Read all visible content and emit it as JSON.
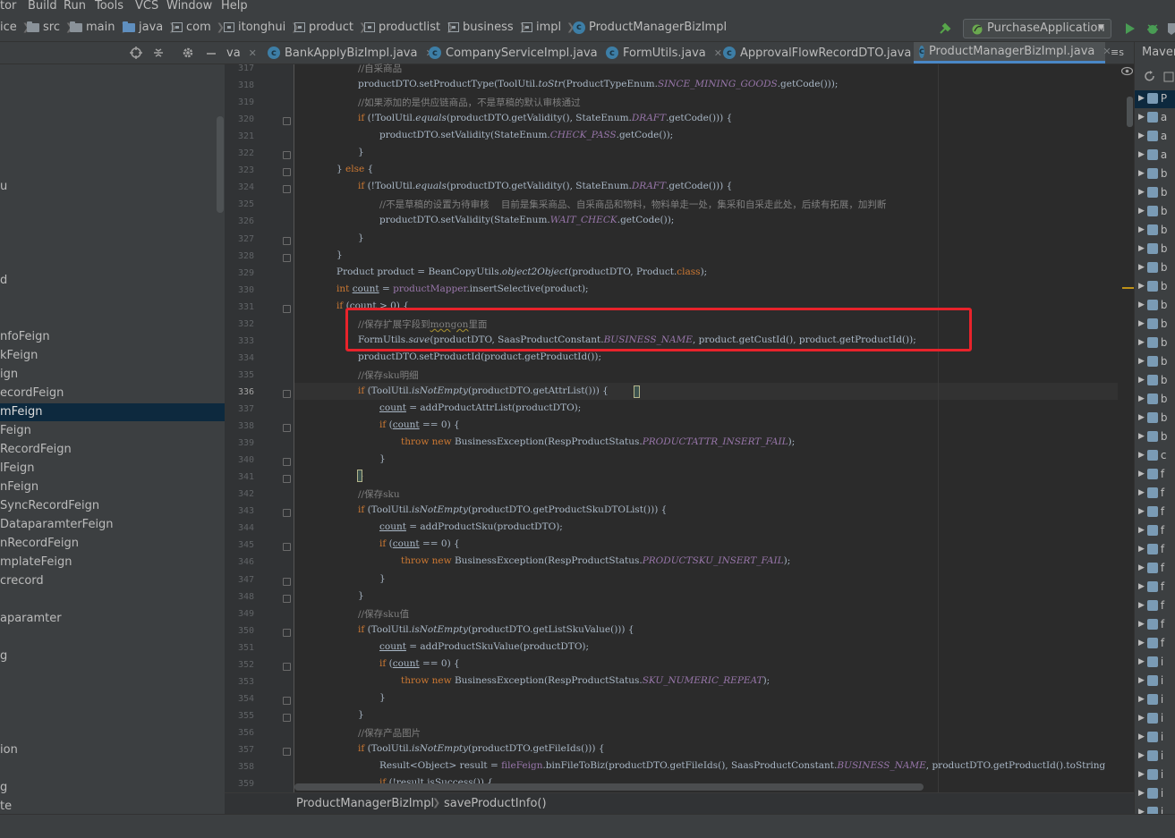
{
  "menu": [
    "tor",
    "Build",
    "Run",
    "Tools",
    "VCS",
    "Window",
    "Help"
  ],
  "breadcrumb": [
    "ice",
    "src",
    "main",
    "java",
    "com",
    "itonghui",
    "product",
    "productlist",
    "business",
    "impl",
    "ProductManagerBizImpl"
  ],
  "run_config": "PurchaseApplication",
  "tabs": [
    {
      "label": "va",
      "active": false
    },
    {
      "label": "BankApplyBizImpl.java",
      "active": false
    },
    {
      "label": "CompanyServiceImpl.java",
      "active": false
    },
    {
      "label": "FormUtils.java",
      "active": false
    },
    {
      "label": "ApprovalFlowRecordDTO.java",
      "active": false
    },
    {
      "label": "ProductManagerBizImpl.java",
      "active": true
    }
  ],
  "tabs_overflow": "≡s",
  "maven_title": "Maven",
  "project_tree": [
    {
      "label": "u",
      "selected": false
    },
    {
      "label": "d",
      "selected": false
    },
    {
      "label": "nfoFeign",
      "selected": false
    },
    {
      "label": "kFeign",
      "selected": false
    },
    {
      "label": "ign",
      "selected": false
    },
    {
      "label": "ecordFeign",
      "selected": false
    },
    {
      "label": "mFeign",
      "selected": true
    },
    {
      "label": "Feign",
      "selected": false
    },
    {
      "label": "RecordFeign",
      "selected": false
    },
    {
      "label": "lFeign",
      "selected": false
    },
    {
      "label": "nFeign",
      "selected": false
    },
    {
      "label": "SyncRecordFeign",
      "selected": false
    },
    {
      "label": "DataparamterFeign",
      "selected": false
    },
    {
      "label": "nRecordFeign",
      "selected": false
    },
    {
      "label": "mplateFeign",
      "selected": false
    },
    {
      "label": "crecord",
      "selected": false
    },
    {
      "label": "aparamter",
      "selected": false
    },
    {
      "label": "g",
      "selected": false
    },
    {
      "label": "ion",
      "selected": false
    },
    {
      "label": "g",
      "selected": false
    },
    {
      "label": "te",
      "selected": false
    }
  ],
  "line_numbers": [
    "317",
    "318",
    "319",
    "320",
    "321",
    "322",
    "323",
    "324",
    "325",
    "326",
    "327",
    "328",
    "329",
    "330",
    "331",
    "332",
    "333",
    "334",
    "335",
    "336",
    "337",
    "338",
    "339",
    "340",
    "341",
    "342",
    "343",
    "344",
    "345",
    "346",
    "347",
    "348",
    "349",
    "350",
    "351",
    "352",
    "353",
    "354",
    "355",
    "356",
    "357",
    "358",
    "359"
  ],
  "current_line": "336",
  "code": [
    [
      {
        "t": "//自采商品",
        "c": "c"
      }
    ],
    [
      {
        "t": "productDTO.setProductType(ToolUtil."
      },
      {
        "t": "toStr",
        "c": "st"
      },
      {
        "t": "(ProductTypeEnum."
      },
      {
        "t": "SINCE_MINING_GOODS",
        "c": "cst"
      },
      {
        "t": ".getCode()));"
      }
    ],
    [
      {
        "t": "//如果添加的是供应链商品，不是草稿的默认审核通过",
        "c": "c"
      }
    ],
    [
      {
        "t": "if",
        "c": "k"
      },
      {
        "t": " (!ToolUtil."
      },
      {
        "t": "equals",
        "c": "st"
      },
      {
        "t": "(productDTO.getValidity(), StateEnum."
      },
      {
        "t": "DRAFT",
        "c": "cst"
      },
      {
        "t": ".getCode())) {"
      }
    ],
    [
      {
        "t": "productDTO.setValidity(StateEnum."
      },
      {
        "t": "CHECK_PASS",
        "c": "cst"
      },
      {
        "t": ".getCode());"
      }
    ],
    [
      {
        "t": "}"
      }
    ],
    [
      {
        "t": "} "
      },
      {
        "t": "else",
        "c": "k"
      },
      {
        "t": " {"
      }
    ],
    [
      {
        "t": "if",
        "c": "k"
      },
      {
        "t": " (!ToolUtil."
      },
      {
        "t": "equals",
        "c": "st"
      },
      {
        "t": "(productDTO.getValidity(), StateEnum."
      },
      {
        "t": "DRAFT",
        "c": "cst"
      },
      {
        "t": ".getCode())) {"
      }
    ],
    [
      {
        "t": "//不是草稿的设置为待审核    目前是集采商品、自采商品和物料，物料单走一处，集采和自采走此处，后续有拓展，加判断",
        "c": "c"
      }
    ],
    [
      {
        "t": "productDTO.setValidity(StateEnum."
      },
      {
        "t": "WAIT_CHECK",
        "c": "cst"
      },
      {
        "t": ".getCode());"
      }
    ],
    [
      {
        "t": "}"
      }
    ],
    [
      {
        "t": "}"
      }
    ],
    [
      {
        "t": "Product product = BeanCopyUtils."
      },
      {
        "t": "object2Object",
        "c": "st"
      },
      {
        "t": "(productDTO, Product."
      },
      {
        "t": "class",
        "c": "k"
      },
      {
        "t": ");"
      }
    ],
    [
      {
        "t": "int",
        "c": "k"
      },
      {
        "t": " "
      },
      {
        "t": "count",
        "c": "ul"
      },
      {
        "t": " = "
      },
      {
        "t": "productMapper",
        "c": "fld"
      },
      {
        "t": ".insertSelective(product);"
      }
    ],
    [
      {
        "t": "if",
        "c": "k"
      },
      {
        "t": " ("
      },
      {
        "t": "count",
        "c": "ul"
      },
      {
        "t": " > 0) {"
      }
    ],
    [
      {
        "t": "//保存扩展字段到",
        "c": "c"
      },
      {
        "t": "mongon",
        "c": "c warn"
      },
      {
        "t": "里面",
        "c": "c"
      }
    ],
    [
      {
        "t": "FormUtils."
      },
      {
        "t": "save",
        "c": "st"
      },
      {
        "t": "(productDTO, SaasProductConstant."
      },
      {
        "t": "BUSINESS_NAME",
        "c": "cst"
      },
      {
        "t": ", product.getCustId(), product.getProductId());"
      }
    ],
    [
      {
        "t": "productDTO.setProductId(product.getProductId());"
      }
    ],
    [
      {
        "t": "//保存sku明细",
        "c": "c"
      }
    ],
    [
      {
        "t": "if",
        "c": "k"
      },
      {
        "t": " (ToolUtil."
      },
      {
        "t": "isNotEmpty",
        "c": "st"
      },
      {
        "t": "(productDTO.getAttrList())) {"
      }
    ],
    [
      {
        "t": "count",
        "c": "ul"
      },
      {
        "t": " = addProductAttrList(productDTO);"
      }
    ],
    [
      {
        "t": "if",
        "c": "k"
      },
      {
        "t": " ("
      },
      {
        "t": "count",
        "c": "ul"
      },
      {
        "t": " == 0) {"
      }
    ],
    [
      {
        "t": "throw",
        "c": "k"
      },
      {
        "t": " "
      },
      {
        "t": "new",
        "c": "k"
      },
      {
        "t": " BusinessException(RespProductStatus."
      },
      {
        "t": "PRODUCTATTR_INSERT_FAIL",
        "c": "cst"
      },
      {
        "t": ");"
      }
    ],
    [
      {
        "t": "}"
      }
    ],
    [
      {
        "t": "}"
      }
    ],
    [
      {
        "t": "//保存sku",
        "c": "c"
      }
    ],
    [
      {
        "t": "if",
        "c": "k"
      },
      {
        "t": " (ToolUtil."
      },
      {
        "t": "isNotEmpty",
        "c": "st"
      },
      {
        "t": "(productDTO.getProductSkuDTOList())) {"
      }
    ],
    [
      {
        "t": "count",
        "c": "ul"
      },
      {
        "t": " = addProductSku(productDTO);"
      }
    ],
    [
      {
        "t": "if",
        "c": "k"
      },
      {
        "t": " ("
      },
      {
        "t": "count",
        "c": "ul"
      },
      {
        "t": " == 0) {"
      }
    ],
    [
      {
        "t": "throw",
        "c": "k"
      },
      {
        "t": " "
      },
      {
        "t": "new",
        "c": "k"
      },
      {
        "t": " BusinessException(RespProductStatus."
      },
      {
        "t": "PRODUCTSKU_INSERT_FAIL",
        "c": "cst"
      },
      {
        "t": ");"
      }
    ],
    [
      {
        "t": "}"
      }
    ],
    [
      {
        "t": "}"
      }
    ],
    [
      {
        "t": "//保存sku值",
        "c": "c"
      }
    ],
    [
      {
        "t": "if",
        "c": "k"
      },
      {
        "t": " (ToolUtil."
      },
      {
        "t": "isNotEmpty",
        "c": "st"
      },
      {
        "t": "(productDTO.getListSkuValue())) {"
      }
    ],
    [
      {
        "t": "count",
        "c": "ul"
      },
      {
        "t": " = addProductSkuValue(productDTO);"
      }
    ],
    [
      {
        "t": "if",
        "c": "k"
      },
      {
        "t": " ("
      },
      {
        "t": "count",
        "c": "ul"
      },
      {
        "t": " == 0) {"
      }
    ],
    [
      {
        "t": "throw",
        "c": "k"
      },
      {
        "t": " "
      },
      {
        "t": "new",
        "c": "k"
      },
      {
        "t": " BusinessException(RespProductStatus."
      },
      {
        "t": "SKU_NUMERIC_REPEAT",
        "c": "cst"
      },
      {
        "t": ");"
      }
    ],
    [
      {
        "t": "}"
      }
    ],
    [
      {
        "t": "}"
      }
    ],
    [
      {
        "t": "//保存产品图片",
        "c": "c"
      }
    ],
    [
      {
        "t": "if",
        "c": "k"
      },
      {
        "t": " (ToolUtil."
      },
      {
        "t": "isNotEmpty",
        "c": "st"
      },
      {
        "t": "(productDTO.getFileIds())) {"
      }
    ],
    [
      {
        "t": "Result<Object> result = "
      },
      {
        "t": "fileFeign",
        "c": "fld"
      },
      {
        "t": ".binFileToBiz(productDTO.getFileIds(), SaasProductConstant."
      },
      {
        "t": "BUSINESS_NAME",
        "c": "cst"
      },
      {
        "t": ", productDTO.getProductId().toString"
      }
    ],
    [
      {
        "t": "if",
        "c": "k"
      },
      {
        "t": " (!result.isSuccess()) {"
      }
    ]
  ],
  "bottom_breadcrumb": [
    "ProductManagerBizImpl",
    "saveProductInfo()"
  ],
  "maven_items": [
    "P",
    "a",
    "a",
    "a",
    "b",
    "b",
    "b",
    "b",
    "b",
    "b",
    "b",
    "b",
    "b",
    "b",
    "b",
    "b",
    "b",
    "b",
    "b",
    "c",
    "f",
    "f",
    "f",
    "f",
    "f",
    "f",
    "f",
    "f",
    "f",
    "f",
    "i",
    "i",
    "i",
    "i",
    "i",
    "i",
    "i",
    "i",
    "i",
    "i"
  ]
}
